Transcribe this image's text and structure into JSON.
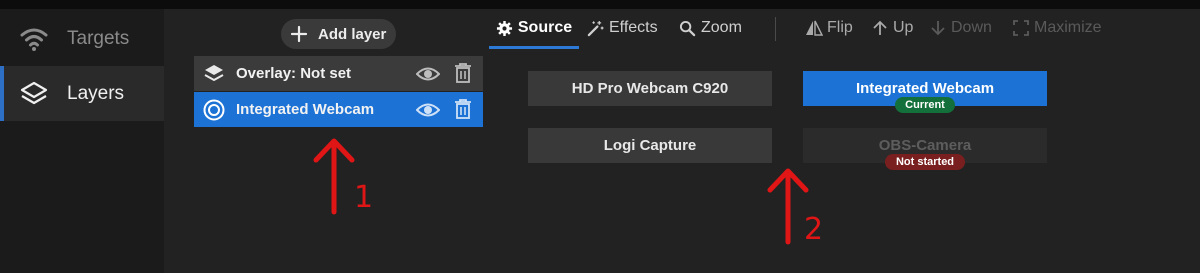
{
  "nav": {
    "items": [
      {
        "label": "Targets",
        "icon": "wifi-icon"
      },
      {
        "label": "Layers",
        "icon": "layers-icon",
        "active": true
      }
    ]
  },
  "layers_panel": {
    "add_label": "Add layer",
    "rows": [
      {
        "name": "Overlay: Not set",
        "icon": "layers-icon",
        "selected": false
      },
      {
        "name": "Integrated Webcam",
        "icon": "webcam-icon",
        "selected": true
      }
    ]
  },
  "source_panel": {
    "tabs": [
      {
        "label": "Source",
        "icon": "gear-icon",
        "active": true
      },
      {
        "label": "Effects",
        "icon": "magic-wand-icon"
      },
      {
        "label": "Zoom",
        "icon": "search-icon"
      }
    ],
    "tools": [
      {
        "label": "Flip",
        "icon": "flip-icon",
        "enabled": true
      },
      {
        "label": "Up",
        "icon": "arrow-up-icon",
        "enabled": true
      },
      {
        "label": "Down",
        "icon": "arrow-down-icon",
        "enabled": false
      },
      {
        "label": "Maximize",
        "icon": "maximize-icon",
        "enabled": false
      }
    ],
    "cameras": [
      {
        "label": "HD Pro Webcam C920"
      },
      {
        "label": "Integrated Webcam",
        "status": "Current"
      },
      {
        "label": "Logi Capture"
      },
      {
        "label": "OBS-Camera",
        "status": "Not started"
      }
    ]
  },
  "annotations": {
    "one": "1",
    "two": "2"
  },
  "colors": {
    "accent": "#1c72d5",
    "current_badge": "#14703a",
    "error_badge": "#7a1f1f",
    "annotation": "#e01515"
  }
}
